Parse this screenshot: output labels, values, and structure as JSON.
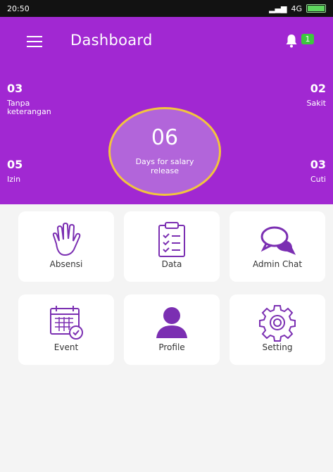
{
  "status_bar": {
    "time": "20:50",
    "network": "4G"
  },
  "app_bar": {
    "title": "Dashboard",
    "notification_count": "1"
  },
  "stats": {
    "top_left": {
      "value": "03",
      "label": "Tanpa keterangan"
    },
    "top_right": {
      "value": "02",
      "label": "Sakit"
    },
    "bottom_left": {
      "value": "05",
      "label": "Izin"
    },
    "bottom_right": {
      "value": "03",
      "label": "Cuti"
    }
  },
  "salary": {
    "days": "06",
    "caption": "Days for salary release"
  },
  "menu": [
    {
      "label": "Absensi",
      "icon": "hand-icon"
    },
    {
      "label": "Data",
      "icon": "clipboard-icon"
    },
    {
      "label": "Admin Chat",
      "icon": "chat-icon"
    },
    {
      "label": "Event",
      "icon": "calendar-icon"
    },
    {
      "label": "Profile",
      "icon": "person-icon"
    },
    {
      "label": "Setting",
      "icon": "gear-icon"
    }
  ],
  "colors": {
    "primary": "#a128d2",
    "accent": "#f2c53d",
    "badge": "#3ec73e"
  }
}
